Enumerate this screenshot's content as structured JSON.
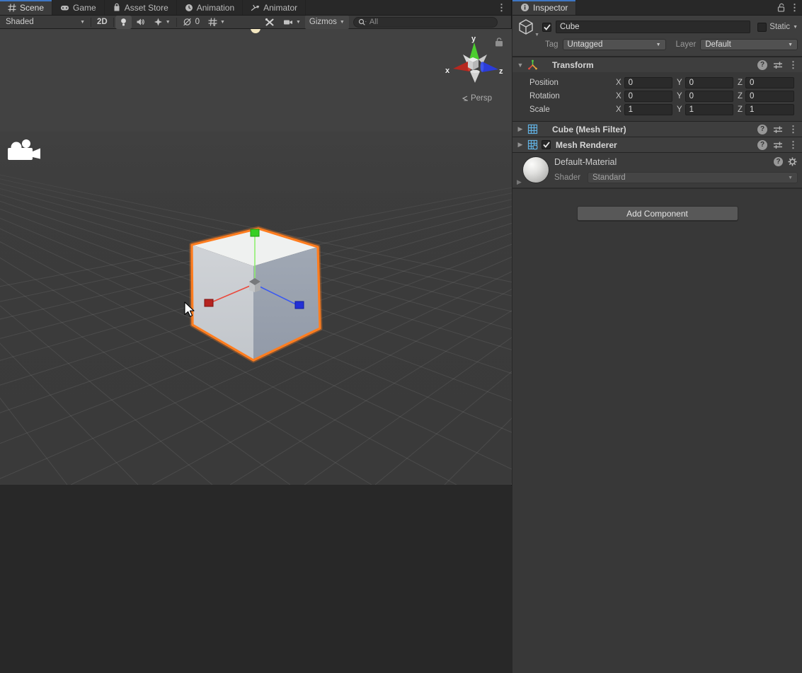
{
  "colors": {
    "active_tab_accent": "#3e76c4",
    "selection_outline_orange": "#ff7d1f",
    "axis_x_red": "#c62f28",
    "axis_y_green": "#43d32a",
    "axis_z_blue": "#2636d8",
    "component_icon_blue": "#61b1e2",
    "panel_bg": "#383838"
  },
  "glyphs": {
    "kebab": "⋮",
    "dropdown_arrow": "▼",
    "foldout_open": "▼",
    "foldout_closed": "▶",
    "help": "?"
  },
  "icons": {
    "scene_tabs": [
      "grid-hash-icon",
      "gamepad-icon",
      "shopping-bag-icon",
      "clock-icon",
      "animator-icon"
    ],
    "toolbar": [
      "light-bulb-icon",
      "audio-speaker-icon",
      "effects-sparkle-icon",
      "visibility-off-icon",
      "grid-snap-icon",
      "tools-wrench-icon",
      "camera-icon",
      "search-magnifier-icon"
    ],
    "inspector": [
      "info-circle-icon",
      "lock-open-icon",
      "kebab-icon",
      "cube-icon",
      "transform-axes-icon",
      "mesh-filter-grid-icon",
      "mesh-renderer-grid-icon",
      "help-circle-icon",
      "presets-sliders-icon",
      "gear-icon"
    ]
  },
  "scene_panel": {
    "tabs": [
      {
        "label": "Scene",
        "active": true
      },
      {
        "label": "Game",
        "active": false
      },
      {
        "label": "Asset Store",
        "active": false
      },
      {
        "label": "Animation",
        "active": false
      },
      {
        "label": "Animator",
        "active": false
      }
    ],
    "toolbar": {
      "shading_mode": "Shaded",
      "mode_2d": "2D",
      "hidden_count": "0",
      "gizmos_label": "Gizmos",
      "search_placeholder": "All"
    },
    "viewport": {
      "projection_label": "Persp",
      "axis_x": "x",
      "axis_y": "y",
      "axis_z": "z"
    }
  },
  "inspector": {
    "tab_label": "Inspector",
    "header": {
      "name": "Cube",
      "static_label": "Static",
      "tag_label": "Tag",
      "tag_value": "Untagged",
      "layer_label": "Layer",
      "layer_value": "Default"
    },
    "transform": {
      "title": "Transform",
      "axis_labels": {
        "x": "X",
        "y": "Y",
        "z": "Z"
      },
      "rows": [
        {
          "label": "Position",
          "x": "0",
          "y": "0",
          "z": "0"
        },
        {
          "label": "Rotation",
          "x": "0",
          "y": "0",
          "z": "0"
        },
        {
          "label": "Scale",
          "x": "1",
          "y": "1",
          "z": "1"
        }
      ]
    },
    "mesh_filter": {
      "title": "Cube (Mesh Filter)"
    },
    "mesh_renderer": {
      "title": "Mesh Renderer"
    },
    "material": {
      "name": "Default-Material",
      "shader_label": "Shader",
      "shader_value": "Standard"
    },
    "add_component_label": "Add Component"
  }
}
